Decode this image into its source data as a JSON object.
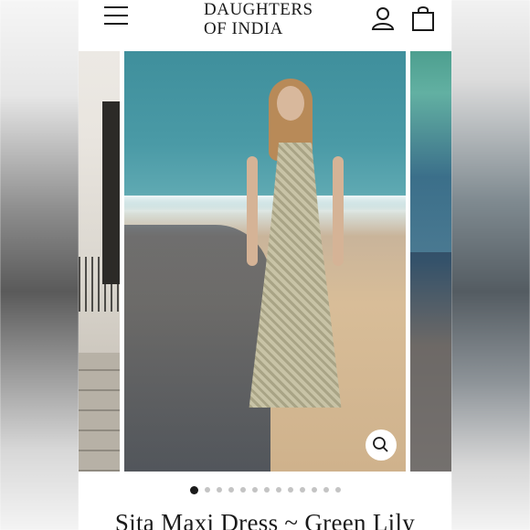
{
  "brand": {
    "line1": "DAUGHTERS",
    "line2": "OF INDIA"
  },
  "header": {
    "menu_icon": "hamburger-menu-icon",
    "account_icon": "user-icon",
    "cart_icon": "shopping-bag-icon"
  },
  "carousel": {
    "slide_count": 13,
    "active_index": 0,
    "zoom_icon": "magnifier-icon"
  },
  "product": {
    "title": "Sita Maxi Dress ~ Green Lily"
  },
  "colors": {
    "text": "#1a1a1a",
    "dot_inactive": "#c4c4c4",
    "dot_active": "#1a1a1a"
  }
}
